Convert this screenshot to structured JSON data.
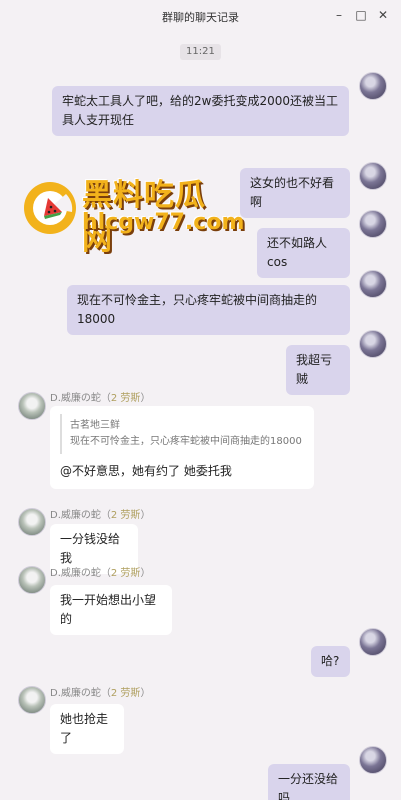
{
  "window": {
    "title": "群聊的聊天记录"
  },
  "chat": {
    "timestamp": "11:21",
    "messages": [
      {
        "side": "right",
        "text": "牢蛇太工具人了吧，给的2w委托变成2000还被当工具人支开现任"
      },
      {
        "side": "right",
        "text": "这女的也不好看啊"
      },
      {
        "side": "right",
        "text": "还不如路人cos"
      },
      {
        "side": "right",
        "text": "现在不可怜金主，只心疼牢蛇被中间商抽走的18000"
      },
      {
        "side": "right",
        "text": "我超亏贼"
      },
      {
        "side": "left",
        "sender": "D.威廉の蛇",
        "badge": "2 劳斯",
        "quote_author": "古茗地三鲜",
        "quote_text": "现在不可怜金主，只心疼牢蛇被中间商抽走的18000",
        "text": "@不好意思，她有约了 她委托我"
      },
      {
        "side": "left",
        "sender": "D.威廉の蛇",
        "badge": "2 劳斯",
        "text": "一分钱没给我"
      },
      {
        "side": "left",
        "sender": "D.威廉の蛇",
        "badge": "2 劳斯",
        "text": "我一开始想出小望的"
      },
      {
        "side": "right",
        "text": "哈?"
      },
      {
        "side": "left",
        "sender": "D.威廉の蛇",
        "badge": "2 劳斯",
        "text": "她也抢走了"
      },
      {
        "side": "right",
        "text": "一分还没给吗"
      }
    ]
  },
  "watermark": {
    "line1": "黑料吃瓜网",
    "line2": "hlcgw77.com"
  }
}
